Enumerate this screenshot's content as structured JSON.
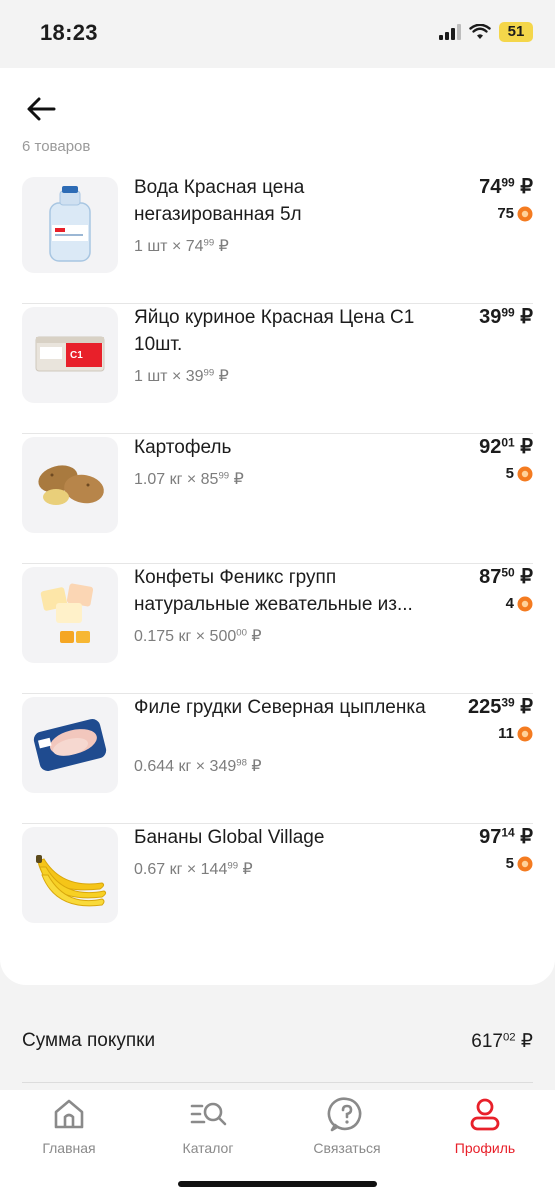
{
  "status_bar": {
    "time": "18:23",
    "battery": "51"
  },
  "header": {
    "items_caption": "6 товаров"
  },
  "items": [
    {
      "name": "Вода Красная цена негазированная 5л",
      "qty_prefix": "1 шт × 74",
      "qty_cents": "99",
      "qty_currency": " ₽",
      "price_main": "74",
      "price_cents": "99",
      "price_currency": " ₽",
      "bonus": "75",
      "icon": "water-bottle-icon"
    },
    {
      "name": "Яйцо куриное Красная Цена С1 10шт.",
      "qty_prefix": "1 шт × 39",
      "qty_cents": "99",
      "qty_currency": " ₽",
      "price_main": "39",
      "price_cents": "99",
      "price_currency": " ₽",
      "bonus": "",
      "icon": "egg-carton-icon"
    },
    {
      "name": "Картофель",
      "qty_prefix": "1.07 кг × 85",
      "qty_cents": "99",
      "qty_currency": " ₽",
      "price_main": "92",
      "price_cents": "01",
      "price_currency": " ₽",
      "bonus": "5",
      "icon": "potato-icon"
    },
    {
      "name": "Конфеты Феникс групп натуральные жевательные из...",
      "qty_prefix": "0.175 кг × 500",
      "qty_cents": "00",
      "qty_currency": " ₽",
      "price_main": "87",
      "price_cents": "50",
      "price_currency": " ₽",
      "bonus": "4",
      "icon": "candy-icon"
    },
    {
      "name": "Филе грудки Северная цыпленка",
      "qty_prefix": "0.644 кг × 349",
      "qty_cents": "98",
      "qty_currency": " ₽",
      "price_main": "225",
      "price_cents": "39",
      "price_currency": " ₽",
      "bonus": "11",
      "icon": "chicken-fillet-icon"
    },
    {
      "name": "Бананы Global Village",
      "qty_prefix": "0.67 кг × 144",
      "qty_cents": "99",
      "qty_currency": " ₽",
      "price_main": "97",
      "price_cents": "14",
      "price_currency": " ₽",
      "bonus": "5",
      "icon": "banana-icon"
    }
  ],
  "summary": {
    "label": "Сумма покупки",
    "value_main": "617",
    "value_cents": "02",
    "currency": " ₽"
  },
  "tabbar": {
    "tabs": [
      {
        "label": "Главная",
        "icon": "home-icon"
      },
      {
        "label": "Каталог",
        "icon": "catalog-search-icon"
      },
      {
        "label": "Связаться",
        "icon": "help-chat-icon"
      },
      {
        "label": "Профиль",
        "icon": "profile-icon"
      }
    ],
    "active": "Профиль"
  },
  "colors": {
    "accent": "#e8202a",
    "bonus_orange": "#f47b20",
    "background": "#f3f3f3"
  }
}
